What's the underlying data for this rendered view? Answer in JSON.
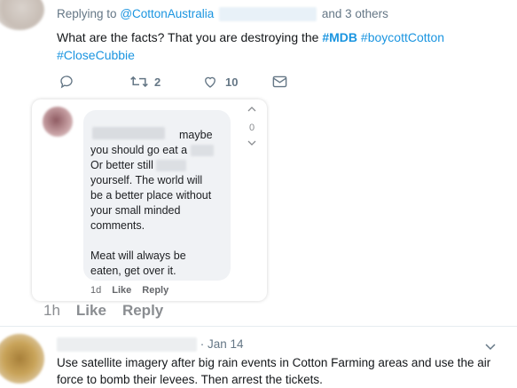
{
  "tweet": {
    "replying_prefix": "Replying to",
    "replying_handle": "@CottonAustralia",
    "and_others": "and 3 others",
    "text_before": "What are the facts? That you are destroying the",
    "tag_mdb": "#MDB",
    "tag_boycott": "#boycottCotton",
    "tag_close": "#CloseCubbie",
    "retweets": "2",
    "likes": "10"
  },
  "comment": {
    "line1": "maybe",
    "line2": "you should go eat a",
    "line3": "Or better still",
    "line4": "yourself. The world will",
    "line5": "be a better place without",
    "line6": "your small minded",
    "line7": "comments.",
    "line8": "Meat will always be",
    "line9": "eaten, get over it.",
    "time": "1d",
    "like": "Like",
    "reply": "Reply",
    "vote_count": "0"
  },
  "post_actions": {
    "time": "1h",
    "like": "Like",
    "reply": "Reply"
  },
  "bottom_tweet": {
    "date": "· Jan 14",
    "text": "Use satellite imagery after big rain events in Cotton Farming areas and use the air force to bomb their levees. Then arrest the tickets."
  },
  "colors": {
    "twitter_blue": "#1b95e0",
    "twitter_grey": "#657786",
    "fb_bubble": "#f0f2f5"
  }
}
